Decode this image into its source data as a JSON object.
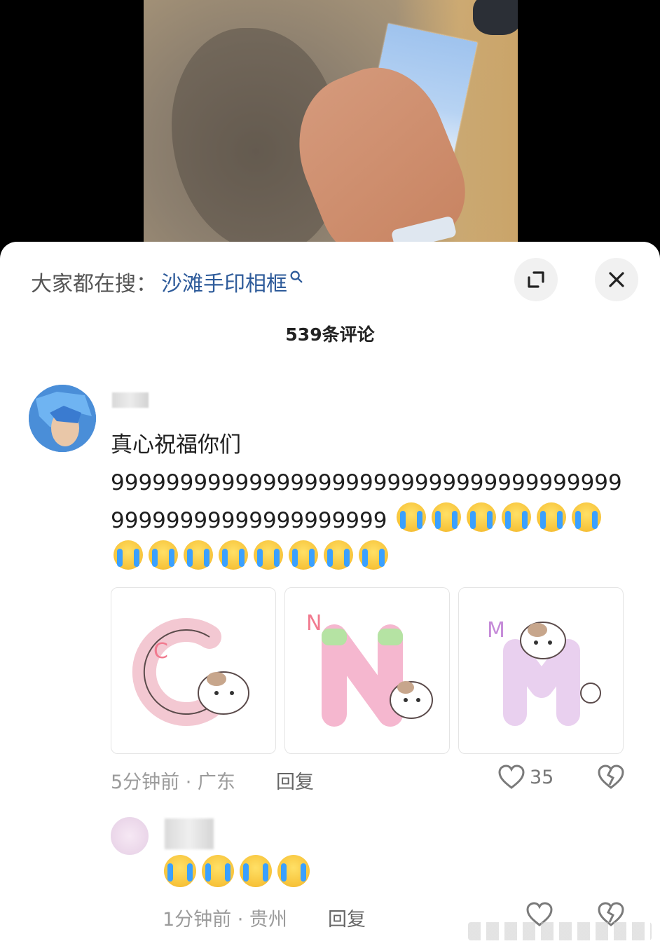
{
  "search": {
    "prefix": "大家都在搜：",
    "term": "沙滩手印相框"
  },
  "comments_header": {
    "title": "539条评论"
  },
  "comment": {
    "text_line": "真心祝福你们",
    "text_digits": "999999999999999999999999999999999999999999999999999999999",
    "emoji_count": 14,
    "stickers": [
      "C",
      "N",
      "M"
    ],
    "time_location": "5分钟前 · 广东",
    "reply_label": "回复",
    "like_count": "35"
  },
  "reply": {
    "emoji_count": 4,
    "time_location": "1分钟前 · 贵州",
    "reply_label": "回复"
  },
  "colors": {
    "search_term": "#2e5b9a",
    "emoji_face": "#f7c33a",
    "emoji_tear": "#3aa0ff"
  },
  "icons": [
    "search-icon",
    "expand-icon",
    "close-icon",
    "heart-icon",
    "dislike-icon"
  ]
}
